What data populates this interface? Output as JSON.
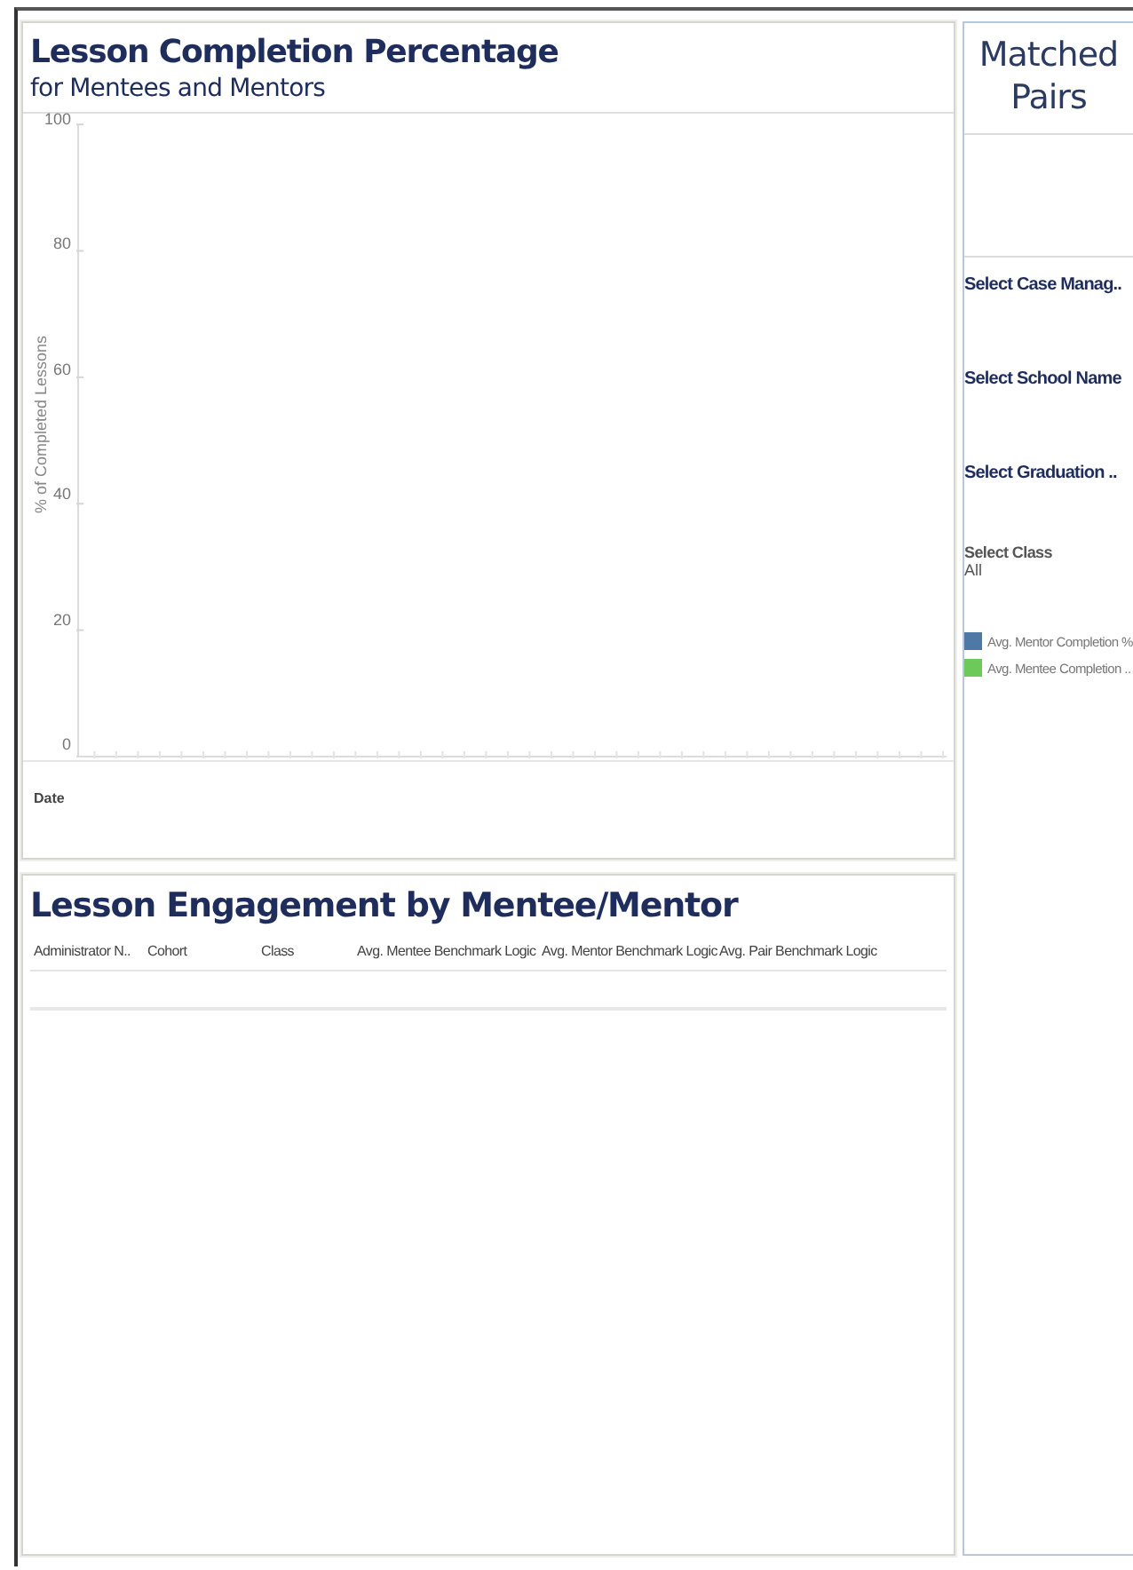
{
  "completion_panel": {
    "title": "Lesson Completion Percentage",
    "subtitle": "for Mentees and Mentors",
    "y_axis": {
      "title": "% of Completed Lessons",
      "ticks": [
        "100",
        "80",
        "60",
        "40",
        "20",
        "0"
      ]
    },
    "x_axis": {
      "title": "Date"
    }
  },
  "engagement_panel": {
    "title": "Lesson Engagement by Mentee/Mentor",
    "table": {
      "columns": [
        "Administrator N..",
        "Cohort",
        "Class",
        "Avg. Mentee Benchmark Logic",
        "Avg. Mentor Benchmark Logic",
        "Avg. Pair Benchmark Logic"
      ]
    }
  },
  "sidebar": {
    "title": "Matched Pairs",
    "filters": [
      {
        "kind": "heading",
        "label": "Select Case Manag.."
      },
      {
        "kind": "heading",
        "label": "Select School Name"
      },
      {
        "kind": "heading",
        "label": "Select Graduation .."
      },
      {
        "kind": "dropdown",
        "label": "Select Class",
        "value": "All"
      }
    ],
    "legend": [
      {
        "label": "Avg. Mentor Completion %",
        "color": "#4e79a7"
      },
      {
        "label": "Avg. Mentee Completion ..",
        "color": "#6cc95a"
      }
    ]
  }
}
